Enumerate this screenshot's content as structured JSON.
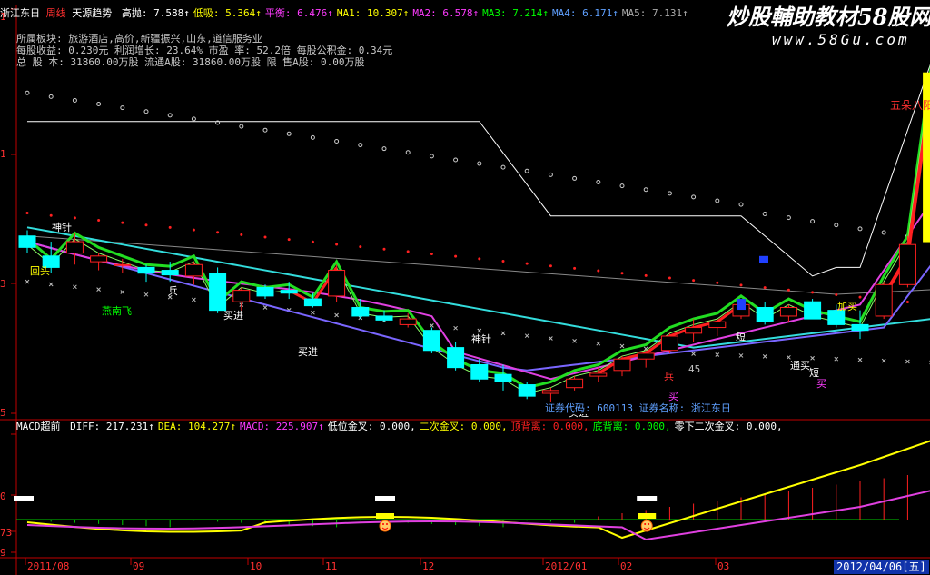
{
  "watermark": {
    "main": "炒股輔助教材58股网",
    "url": "www.58Gu.com"
  },
  "header": {
    "stock": "浙江东日",
    "period": "周线",
    "indicator": "天源趋势",
    "items": [
      {
        "label": "高抛:",
        "value": "7.588↑",
        "color": "#ffffff"
      },
      {
        "label": "低吸:",
        "value": "5.364↑",
        "color": "#ffff00"
      },
      {
        "label": "平衡:",
        "value": "6.476↑",
        "color": "#ff3bff"
      },
      {
        "label": "MA1:",
        "value": "10.307↑",
        "color": "#ffff00"
      },
      {
        "label": "MA2:",
        "value": "6.578↑",
        "color": "#ff3bff"
      },
      {
        "label": "MA3:",
        "value": "7.214↑",
        "color": "#00ff00"
      },
      {
        "label": "MA4:",
        "value": "6.171↑",
        "color": "#5fa0ff"
      },
      {
        "label": "MA5:",
        "value": "7.131↑",
        "color": "#aaaaaa"
      }
    ]
  },
  "info": {
    "line1": "所属板块: 旅游酒店,高价,新疆振兴,山东,道信服务业",
    "line2": "每股收益: 0.230元    利润增长: 23.64%    市盈 率: 52.2倍    每股公积金: 0.34元",
    "line3": "总 股 本: 31860.00万股   流通A股: 31860.00万股   限 售A股: 0.00万股"
  },
  "signals": {
    "shenzhen1": "神针",
    "huitou": "回头",
    "yannanfei": "燕南飞",
    "bing1": "兵",
    "maijin1": "买进",
    "maijin2": "买进",
    "shenzhen2": "神针",
    "maijin3": "买进",
    "bing2": "兵",
    "num45": "45",
    "mai1": "买",
    "duan1": "短",
    "jiamai": "加买",
    "duan2": "短",
    "mai2": "买",
    "tongmai": "通买",
    "wuyinglian": "五朵八阳"
  },
  "tooltip": {
    "code_label": "证券代码:",
    "code": "600113",
    "name_label": "证券名称:",
    "name": "浙江东日"
  },
  "macd": {
    "title": "MACD超前",
    "items": [
      {
        "label": "DIFF:",
        "value": "217.231↑",
        "color": "#ffffff"
      },
      {
        "label": "DEA:",
        "value": "104.277↑",
        "color": "#ffff00"
      },
      {
        "label": "MACD:",
        "value": "225.907↑",
        "color": "#ff3bff"
      },
      {
        "label": "低位金叉:",
        "value": "0.000,",
        "color": "#ffffff"
      },
      {
        "label": "二次金叉:",
        "value": "0.000,",
        "color": "#ffff00"
      },
      {
        "label": "顶背离:",
        "value": "0.000,",
        "color": "#ff2020"
      },
      {
        "label": "底背离:",
        "value": "0.000,",
        "color": "#00ff00"
      },
      {
        "label": "零下二次金叉:",
        "value": "0.000,",
        "color": "#ffffff"
      }
    ]
  },
  "axis_labels": {
    "y1": "1",
    "y2": "3",
    "y3": "5",
    "m1": "0",
    "m2": "73",
    "m3": "9",
    "top": "1"
  },
  "chart_data": {
    "type": "candlestick",
    "x_labels": [
      "2011/08",
      "09",
      "10",
      "11",
      "12",
      "2012/01",
      "02",
      "03"
    ],
    "current_date": "2012/04/06[五]",
    "ohlc": [
      [
        6.4,
        6.5,
        6.1,
        6.2
      ],
      [
        6.05,
        6.3,
        5.75,
        5.85
      ],
      [
        6.1,
        6.45,
        5.9,
        6.3
      ],
      [
        5.95,
        6.1,
        5.8,
        6.05
      ],
      [
        5.9,
        6.0,
        5.75,
        5.9
      ],
      [
        5.85,
        5.9,
        5.6,
        5.75
      ],
      [
        5.8,
        5.95,
        5.6,
        5.72
      ],
      [
        5.7,
        5.95,
        5.55,
        5.9
      ],
      [
        5.75,
        5.85,
        5.05,
        5.1
      ],
      [
        5.25,
        5.5,
        5.1,
        5.45
      ],
      [
        5.5,
        5.55,
        5.3,
        5.35
      ],
      [
        5.45,
        5.6,
        5.3,
        5.4
      ],
      [
        5.3,
        5.4,
        5.15,
        5.18
      ],
      [
        5.35,
        5.9,
        5.25,
        5.8
      ],
      [
        5.15,
        5.3,
        4.95,
        5.0
      ],
      [
        5.0,
        5.1,
        4.9,
        4.93
      ],
      [
        4.85,
        5.05,
        4.8,
        4.95
      ],
      [
        4.75,
        4.8,
        4.35,
        4.4
      ],
      [
        4.45,
        4.55,
        4.05,
        4.1
      ],
      [
        4.15,
        4.25,
        3.85,
        3.9
      ],
      [
        3.98,
        4.15,
        3.7,
        3.85
      ],
      [
        3.8,
        3.85,
        3.55,
        3.6
      ],
      [
        3.65,
        3.75,
        3.5,
        3.7
      ],
      [
        3.75,
        3.95,
        3.7,
        3.9
      ],
      [
        3.95,
        4.1,
        3.85,
        4.0
      ],
      [
        4.05,
        4.3,
        3.95,
        4.25
      ],
      [
        4.25,
        4.4,
        4.1,
        4.35
      ],
      [
        4.4,
        4.7,
        4.35,
        4.65
      ],
      [
        4.7,
        4.95,
        4.55,
        4.8
      ],
      [
        4.8,
        4.95,
        4.65,
        4.9
      ],
      [
        5.0,
        5.25,
        4.95,
        5.2
      ],
      [
        5.15,
        5.25,
        4.85,
        4.9
      ],
      [
        5.0,
        5.2,
        4.9,
        5.15
      ],
      [
        5.25,
        5.3,
        4.95,
        4.95
      ],
      [
        5.1,
        5.2,
        4.8,
        4.85
      ],
      [
        4.85,
        5.1,
        4.6,
        4.75
      ],
      [
        5.0,
        5.6,
        4.95,
        5.55
      ],
      [
        5.55,
        6.4,
        5.5,
        6.25
      ],
      [
        6.3,
        9.3,
        6.25,
        9.25
      ],
      [
        9.3,
        9.8,
        9.2,
        9.6
      ]
    ]
  },
  "colors": {
    "up": "#ff2020",
    "down": "#00ffff",
    "axis": "#c00000",
    "yellowbar": "#ffff00"
  }
}
